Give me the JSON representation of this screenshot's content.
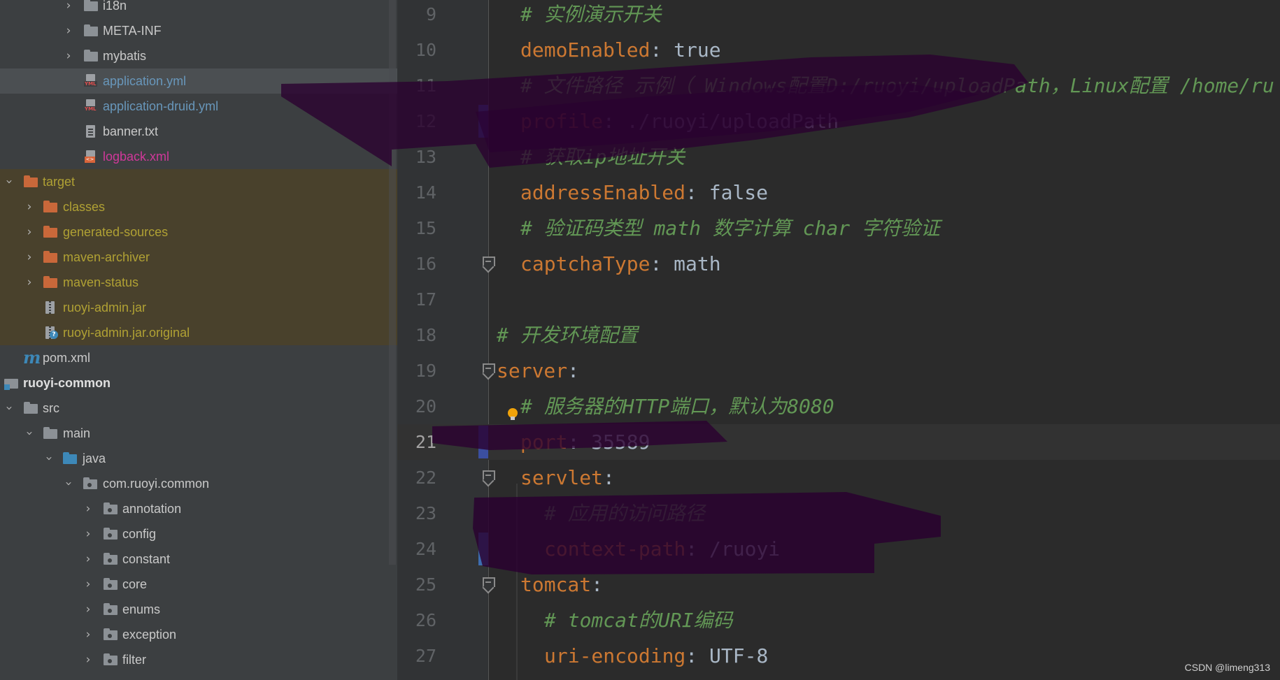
{
  "project_tree": {
    "items": [
      {
        "label": "i18n",
        "type": "folder",
        "color": "#c9c9c9",
        "expanded": false
      },
      {
        "label": "META-INF",
        "type": "folder",
        "color": "#c9c9c9",
        "expanded": false
      },
      {
        "label": "mybatis",
        "type": "folder",
        "color": "#c9c9c9",
        "expanded": false
      },
      {
        "label": "application.yml",
        "type": "yml-file",
        "color": "#6897bb",
        "selected": true
      },
      {
        "label": "application-druid.yml",
        "type": "yml-file",
        "color": "#6897bb"
      },
      {
        "label": "banner.txt",
        "type": "text-file",
        "color": "#c9c9c9"
      },
      {
        "label": "logback.xml",
        "type": "xml-file",
        "color": "#c9c9c9"
      },
      {
        "label": "target",
        "type": "excluded-folder",
        "color": "#b0a134",
        "expanded": true
      },
      {
        "label": "classes",
        "type": "excluded-folder",
        "color": "#b0a134",
        "expanded": false
      },
      {
        "label": "generated-sources",
        "type": "excluded-folder",
        "color": "#b0a134",
        "expanded": false
      },
      {
        "label": "maven-archiver",
        "type": "excluded-folder",
        "color": "#b0a134",
        "expanded": false
      },
      {
        "label": "maven-status",
        "type": "excluded-folder",
        "color": "#b0a134",
        "expanded": false
      },
      {
        "label": "ruoyi-admin.jar",
        "type": "jar-file",
        "color": "#b0a134"
      },
      {
        "label": "ruoyi-admin.jar.original",
        "type": "jar-original-file",
        "color": "#b0a134"
      },
      {
        "label": "pom.xml",
        "type": "maven-file",
        "color": "#c9c9c9"
      },
      {
        "label": "ruoyi-common",
        "type": "module",
        "color": "#e0e0e0",
        "expanded": true
      },
      {
        "label": "src",
        "type": "folder",
        "color": "#c9c9c9",
        "expanded": true
      },
      {
        "label": "main",
        "type": "folder",
        "color": "#c9c9c9",
        "expanded": true
      },
      {
        "label": "java",
        "type": "source-folder",
        "color": "#c9c9c9",
        "expanded": true
      },
      {
        "label": "com.ruoyi.common",
        "type": "package",
        "color": "#c9c9c9",
        "expanded": true
      },
      {
        "label": "annotation",
        "type": "package",
        "color": "#c9c9c9",
        "expanded": false
      },
      {
        "label": "config",
        "type": "package",
        "color": "#c9c9c9",
        "expanded": false
      },
      {
        "label": "constant",
        "type": "package",
        "color": "#c9c9c9",
        "expanded": false
      },
      {
        "label": "core",
        "type": "package",
        "color": "#c9c9c9",
        "expanded": false
      },
      {
        "label": "enums",
        "type": "package",
        "color": "#c9c9c9",
        "expanded": false
      },
      {
        "label": "exception",
        "type": "package",
        "color": "#c9c9c9",
        "expanded": false
      },
      {
        "label": "filter",
        "type": "package",
        "color": "#c9c9c9",
        "expanded": false
      }
    ]
  },
  "editor": {
    "current_line": "21",
    "lines": [
      {
        "num": "9",
        "indent": 1,
        "comment": "# 实例演示开关"
      },
      {
        "num": "10",
        "indent": 1,
        "key": "demoEnabled",
        "sep": ": ",
        "value": "true"
      },
      {
        "num": "11",
        "indent": 1,
        "comment": "# 文件路径 示例（ Windows配置D:/ruoyi/uploadPath，Linux配置 /home/ru"
      },
      {
        "num": "12",
        "indent": 1,
        "key": "profile",
        "sep": ": ",
        "value": "./ruoyi/uploadPath"
      },
      {
        "num": "13",
        "indent": 1,
        "comment": "# 获取ip地址开关"
      },
      {
        "num": "14",
        "indent": 1,
        "key": "addressEnabled",
        "sep": ": ",
        "value": "false"
      },
      {
        "num": "15",
        "indent": 1,
        "comment": "# 验证码类型 math 数字计算 char 字符验证"
      },
      {
        "num": "16",
        "indent": 1,
        "key": "captchaType",
        "sep": ": ",
        "value": "math"
      },
      {
        "num": "17",
        "indent": 0
      },
      {
        "num": "18",
        "indent": 0,
        "comment": "# 开发环境配置"
      },
      {
        "num": "19",
        "indent": 0,
        "key": "server",
        "sep": ":"
      },
      {
        "num": "20",
        "indent": 1,
        "comment": "# 服务器的HTTP端口，默认为8080"
      },
      {
        "num": "21",
        "indent": 1,
        "key": "port",
        "sep": ": ",
        "value": "35589"
      },
      {
        "num": "22",
        "indent": 1,
        "key": "servlet",
        "sep": ":"
      },
      {
        "num": "23",
        "indent": 2,
        "comment": "# 应用的访问路径"
      },
      {
        "num": "24",
        "indent": 2,
        "key": "context-path",
        "sep": ": ",
        "value": "/ruoyi"
      },
      {
        "num": "25",
        "indent": 1,
        "key": "tomcat",
        "sep": ":"
      },
      {
        "num": "26",
        "indent": 2,
        "comment": "# tomcat的URI编码"
      },
      {
        "num": "27",
        "indent": 2,
        "key": "uri-encoding",
        "sep": ": ",
        "value": "UTF-8"
      }
    ]
  },
  "watermark": "CSDN @limeng313",
  "colors": {
    "key": "#cc7832",
    "value": "#a9b7c6",
    "comment": "#629755",
    "tree_bg": "#3c3f41",
    "editor_bg": "#2b2b2b",
    "gutter_bg": "#313335",
    "excluded_bg": "#49412c",
    "redaction": "#2a0030"
  }
}
